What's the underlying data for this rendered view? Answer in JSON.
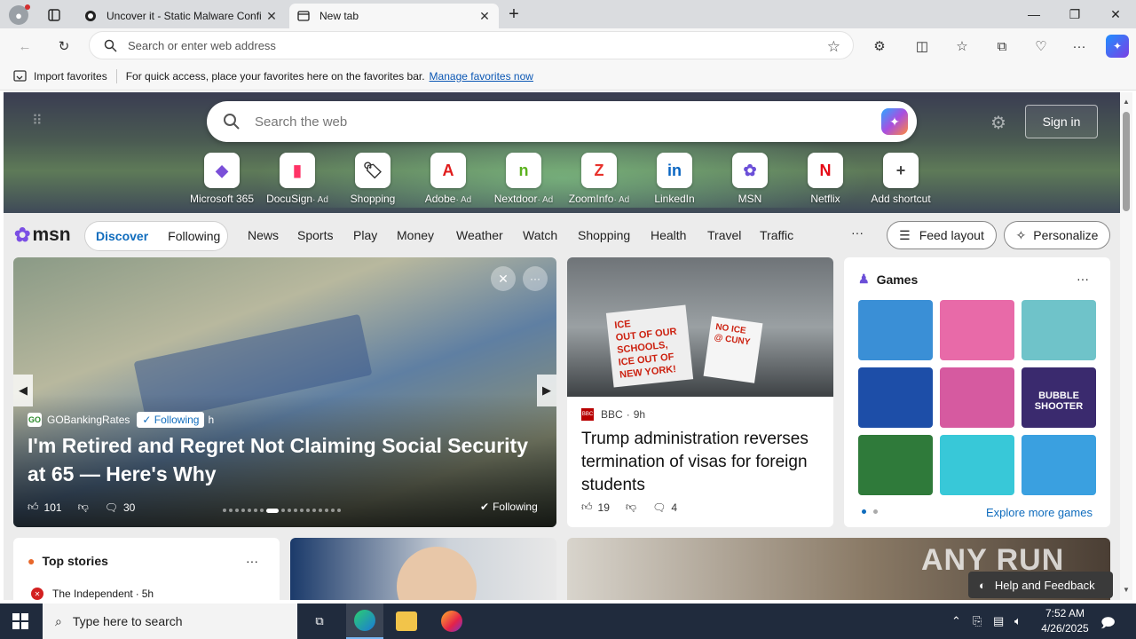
{
  "browser": {
    "tabs": [
      {
        "label": "Uncover it - Static Malware Confi",
        "active": false
      },
      {
        "label": "New tab",
        "active": true
      }
    ],
    "address_placeholder": "Search or enter web address",
    "favorites_bar": {
      "import_label": "Import favorites",
      "hint_text": "For quick access, place your favorites here on the favorites bar.",
      "manage_link": "Manage favorites now"
    }
  },
  "newtab": {
    "search_placeholder": "Search the web",
    "sign_in_label": "Sign in",
    "shortcuts": [
      {
        "label": "Microsoft 365",
        "ad": "",
        "glyph": "◆",
        "color": "#7a4fd8"
      },
      {
        "label": "DocuSign",
        "ad": "· Ad",
        "glyph": "▮",
        "color": "#ff3366"
      },
      {
        "label": "Shopping",
        "ad": "",
        "glyph": "🏷",
        "color": "#333333"
      },
      {
        "label": "Adobe",
        "ad": "· Ad",
        "glyph": "A",
        "color": "#e01b1b"
      },
      {
        "label": "Nextdoor",
        "ad": "· Ad",
        "glyph": "n",
        "color": "#5cb21f"
      },
      {
        "label": "ZoomInfo",
        "ad": "· Ad",
        "glyph": "Z",
        "color": "#e8322c"
      },
      {
        "label": "LinkedIn",
        "ad": "",
        "glyph": "in",
        "color": "#0a66c2"
      },
      {
        "label": "MSN",
        "ad": "",
        "glyph": "✿",
        "color": "#6b4fd8"
      },
      {
        "label": "Netflix",
        "ad": "",
        "glyph": "N",
        "color": "#e50914"
      },
      {
        "label": "Add shortcut",
        "ad": "",
        "glyph": "+",
        "color": "#444444"
      }
    ]
  },
  "msn": {
    "logo": "msn",
    "toggle": {
      "discover": "Discover",
      "following": "Following"
    },
    "nav": [
      "News",
      "Sports",
      "Play",
      "Money",
      "Weather",
      "Watch",
      "Shopping",
      "Health",
      "Travel",
      "Traffic"
    ],
    "more": "···",
    "feed_layout": "Feed layout",
    "personalize": "Personalize"
  },
  "hero_story": {
    "source": "GOBankingRates",
    "following_badge": "Following",
    "age": "h",
    "headline": "I'm Retired and Regret Not Claiming Social Security at 65 — Here's Why",
    "likes": "101",
    "comments": "30",
    "following_chip": "Following"
  },
  "bbc_story": {
    "source": "BBC",
    "age": "9h",
    "headline": "Trump administration reverses termination of visas for foreign students",
    "likes": "19",
    "comments": "4"
  },
  "games": {
    "title": "Games",
    "explore": "Explore more games",
    "tile_colors": [
      "#3a8fd6",
      "#e86aa8",
      "#6fc3c9",
      "#1d4ea8",
      "#d65aa0",
      "#3a2a6e",
      "#2f7a3a",
      "#38c8d8",
      "#3aa0e0"
    ],
    "bubble_text": "BUBBLE SHOOTER"
  },
  "top_stories": {
    "title": "Top stories",
    "item_source": "The Independent",
    "item_age": "5h"
  },
  "help": {
    "label": "Help and Feedback"
  },
  "watermark": "ANY RUN",
  "taskbar": {
    "search_placeholder": "Type here to search",
    "time": "7:52 AM",
    "date": "4/26/2025"
  }
}
